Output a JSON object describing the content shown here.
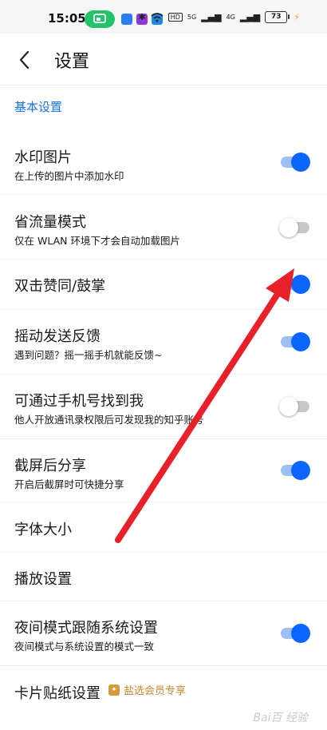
{
  "status_bar": {
    "time": "15:05",
    "network": "HD",
    "signal1": "5G",
    "signal2": "4G",
    "battery": "73"
  },
  "header": {
    "title": "设置",
    "back_icon": "chevron-left-icon"
  },
  "section": {
    "title": "基本设置"
  },
  "settings": [
    {
      "title": "水印图片",
      "subtitle": "在上传的图片中添加水印",
      "toggle": "on"
    },
    {
      "title": "省流量模式",
      "subtitle": "仅在 WLAN 环境下才会自动加载图片",
      "toggle": "off"
    },
    {
      "title": "双击赞同/鼓掌",
      "subtitle": "",
      "toggle": "on"
    },
    {
      "title": "摇动发送反馈",
      "subtitle": "遇到问题？摇一摇手机就能反馈~",
      "toggle": "on"
    },
    {
      "title": "可通过手机号找到我",
      "subtitle": "他人开放通讯录权限后可发现我的知乎账号",
      "toggle": "off"
    },
    {
      "title": "截屏后分享",
      "subtitle": "开启后截屏时可快捷分享",
      "toggle": "on"
    },
    {
      "title": "字体大小",
      "subtitle": ""
    },
    {
      "title": "播放设置",
      "subtitle": ""
    },
    {
      "title": "夜间模式跟随系统设置",
      "subtitle": "夜间模式与系统设置的模式一致",
      "toggle": "on"
    },
    {
      "title": "卡片贴纸设置",
      "badge": "盐选会员专享"
    }
  ],
  "colors": {
    "accent": "#0a66ff",
    "section": "#1a73e8",
    "badge": "#c5882f",
    "annotation_arrow": "#e8202a"
  },
  "watermark": "Bai百 经验"
}
